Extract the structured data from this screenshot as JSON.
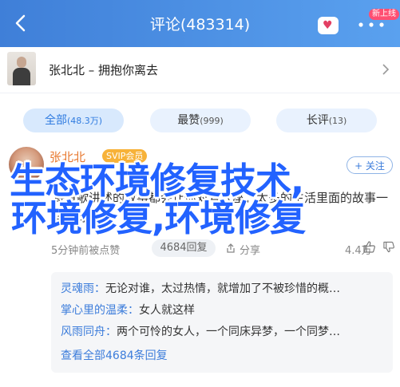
{
  "header": {
    "title": "评论(483314)",
    "badge": "新上线",
    "back_icon": "chevron-left-icon",
    "more_icon": "more-dots-icon",
    "colors": {
      "start": "#3f7fd8",
      "end": "#5aa1ef"
    }
  },
  "song": {
    "title": "张北北 – 拥抱你离去",
    "chevron_icon": "chevron-right-icon"
  },
  "tabs": [
    {
      "label": "全部",
      "count": "(48.3万)",
      "active": true
    },
    {
      "label": "最赞",
      "count": "(999)",
      "active": false
    },
    {
      "label": "长评",
      "count": "(13)",
      "active": false
    }
  ],
  "comment": {
    "user": "张北北",
    "vip": "SVIP会员",
    "follow": "+ 关注",
    "body": "每首歌讲述的故事都会让你对号入座；太多的生活里面的故事一样让你流泪",
    "time": "5分钟前被点赞",
    "replies_label": "4684回复",
    "share_label": "分享",
    "likes": "4.4万",
    "replies": [
      {
        "name": "灵魂雨：",
        "text": "无论对谁，太过热情，就增加了不被珍惜的概…"
      },
      {
        "name": "掌心里的温柔：",
        "text": "女人就这样"
      },
      {
        "name": "风雨同舟：",
        "text": "两个可怜的女人，一个同床异梦，一个同梦…"
      }
    ],
    "view_all": "查看全部4684条回复"
  },
  "overlay": {
    "line1": "生态环境修复技术,",
    "line2": "环境修复,环境修复",
    "color": "#2262ff"
  }
}
